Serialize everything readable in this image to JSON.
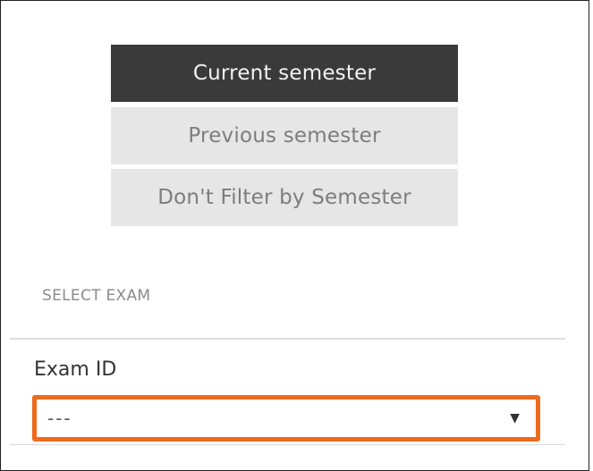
{
  "semester_filter": {
    "options": [
      {
        "label": "Current semester",
        "selected": true
      },
      {
        "label": "Previous semester",
        "selected": false
      },
      {
        "label": "Don't Filter by Semester",
        "selected": false
      }
    ]
  },
  "select_exam": {
    "heading": "SELECT EXAM",
    "field_label": "Exam ID",
    "selected_value": "---",
    "arrow_icon": "caret-down-icon",
    "highlight_color": "#ee6a1c"
  },
  "colors": {
    "active_bg": "#3a3a3a",
    "active_text": "#f2f2f2",
    "inactive_bg": "#e6e6e6",
    "inactive_text": "#7d7d7d"
  }
}
